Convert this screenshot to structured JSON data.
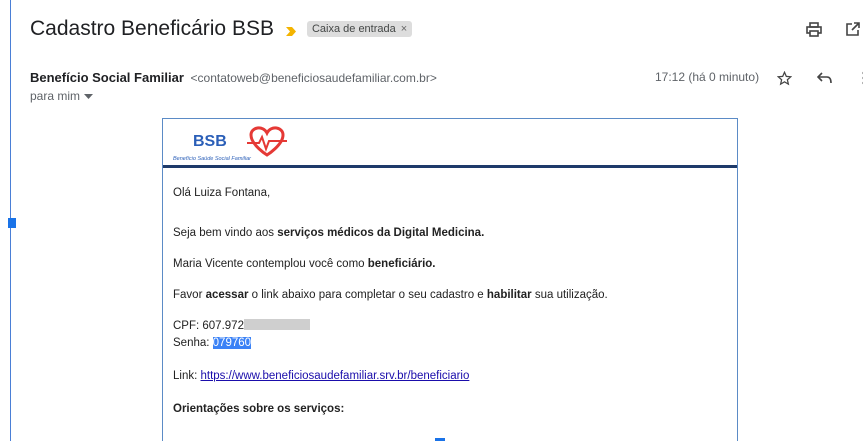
{
  "email": {
    "subject": "Cadastro Beneficário BSB",
    "label": "Caixa de entrada",
    "label_close": "×",
    "sender_name": "Benefício Social Familiar",
    "sender_email": "<contatoweb@beneficiosaudefamiliar.com.br>",
    "to_label": "para mim",
    "time": "17:12 (há 0 minuto)"
  },
  "logo": {
    "text": "BSB",
    "tagline": "Benefício Saúde Social Familiar"
  },
  "body": {
    "greeting": "Olá Luiza Fontana,",
    "line1_pre": "Seja bem vindo aos ",
    "line1_bold": "serviços médicos da Digital Medicina.",
    "line2_pre": "Maria Vicente contemplou você como ",
    "line2_bold": "beneficiário.",
    "line3_a": "Favor ",
    "line3_b": "acessar",
    "line3_c": " o link abaixo para completar o seu cadastro e ",
    "line3_d": "habilitar",
    "line3_e": " sua utilização.",
    "cpf_label": "CPF: 607.972",
    "senha_label": "Senha: ",
    "senha_value": "079760",
    "link_label": "Link: ",
    "link_url": "https://www.beneficiosaudefamiliar.srv.br/beneficiario",
    "orientacoes": "Orientações sobre os serviços:"
  },
  "colors": {
    "accent": "#1a73e8",
    "logo_blue": "#2b5fb8",
    "logo_red": "#e53935",
    "banner_rule": "#1e3a6a",
    "important_marker": "#f4b400"
  }
}
